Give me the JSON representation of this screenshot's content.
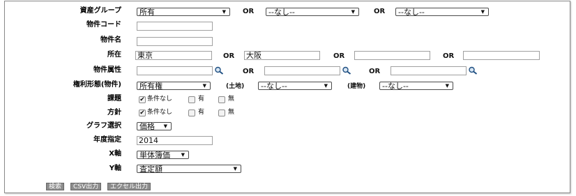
{
  "form": {
    "asset_group": {
      "label": "資産グループ",
      "select1": "所有",
      "or1": "OR",
      "select2": "--なし--",
      "or2": "OR",
      "select3": "--なし--"
    },
    "property_code": {
      "label": "物件コード",
      "value": ""
    },
    "property_name": {
      "label": "物件名",
      "value": ""
    },
    "location": {
      "label": "所在",
      "value1": "東京",
      "or1": "OR",
      "value2": "大阪",
      "or2": "OR",
      "value3": "",
      "or3": "OR",
      "value4": ""
    },
    "property_attr": {
      "label": "物件属性",
      "value1": "",
      "or1": "OR",
      "value2": "",
      "or2": "OR",
      "value3": ""
    },
    "rights": {
      "label": "権利形態(物件)",
      "select1": "所有権",
      "land_label": "(土地)",
      "select2": "--なし--",
      "building_label": "(建物)",
      "select3": "--なし--"
    },
    "issues": {
      "label": "課題",
      "opt_none": "条件なし",
      "opt_yes": "有",
      "opt_no": "無"
    },
    "policy": {
      "label": "方針",
      "opt_none": "条件なし",
      "opt_yes": "有",
      "opt_no": "無"
    },
    "graph": {
      "label": "グラフ選択",
      "value": "価格"
    },
    "fiscal_year": {
      "label": "年度指定",
      "value": "2014"
    },
    "x_axis": {
      "label": "X軸",
      "value": "単体簿価"
    },
    "y_axis": {
      "label": "Y軸",
      "value": "査定額"
    }
  },
  "buttons": {
    "search": "検索",
    "csv": "CSV出力",
    "excel": "エクセル出力"
  },
  "colors": {
    "button_bg": "#8c8c8c",
    "frame_border": "#8a8a8a"
  }
}
